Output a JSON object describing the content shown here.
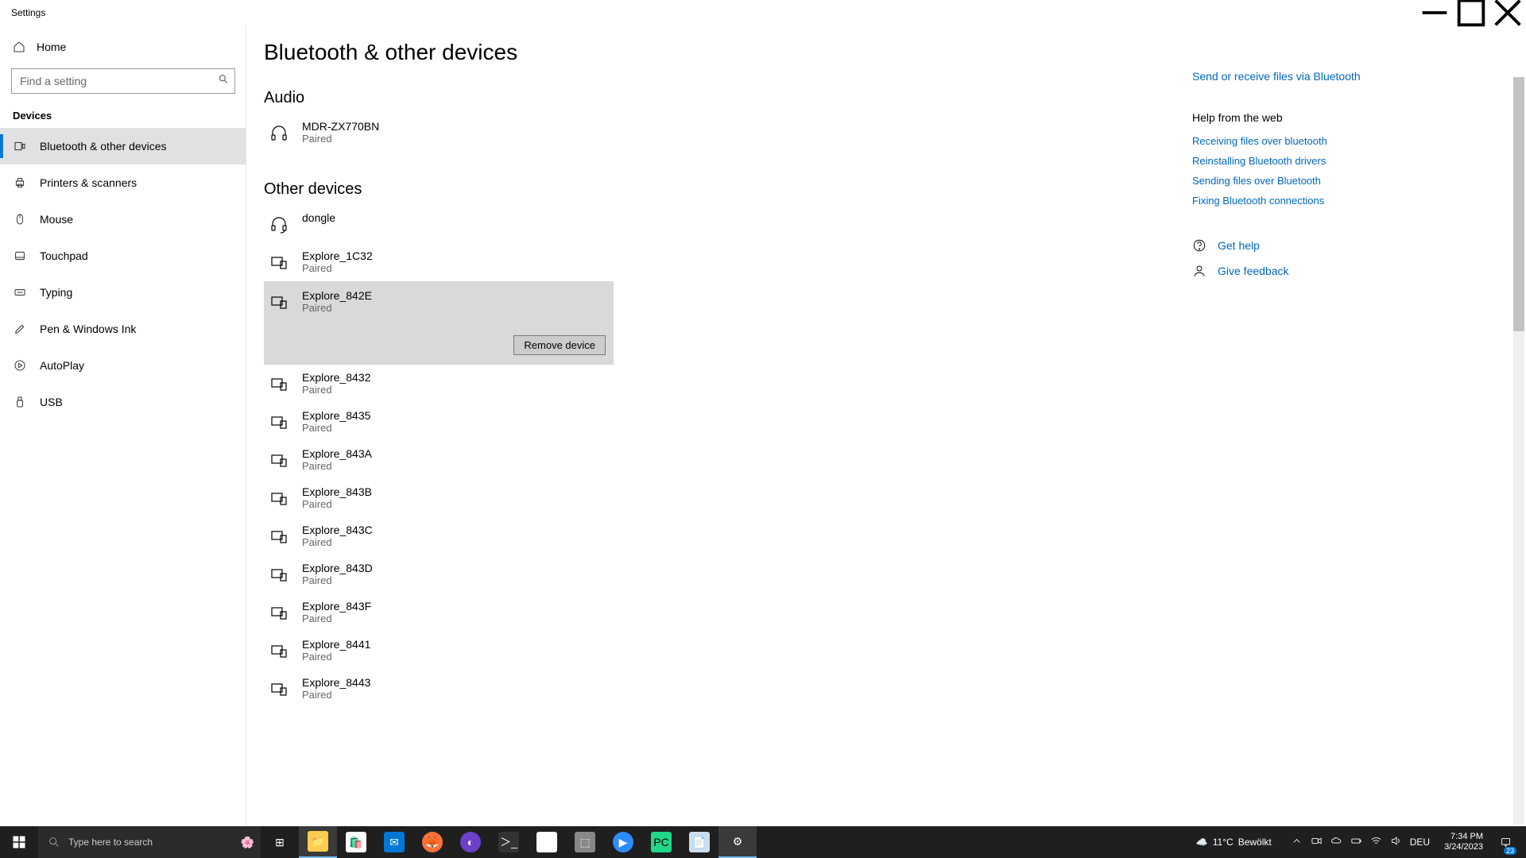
{
  "window": {
    "title": "Settings"
  },
  "sidebar": {
    "home": "Home",
    "search_placeholder": "Find a setting",
    "section": "Devices",
    "items": [
      {
        "label": "Bluetooth & other devices"
      },
      {
        "label": "Printers & scanners"
      },
      {
        "label": "Mouse"
      },
      {
        "label": "Touchpad"
      },
      {
        "label": "Typing"
      },
      {
        "label": "Pen & Windows Ink"
      },
      {
        "label": "AutoPlay"
      },
      {
        "label": "USB"
      }
    ]
  },
  "page": {
    "title": "Bluetooth & other devices",
    "audio_section": "Audio",
    "other_section": "Other devices",
    "remove_label": "Remove device",
    "audio_devices": [
      {
        "name": "MDR-ZX770BN",
        "status": "Paired"
      }
    ],
    "other_devices": [
      {
        "name": "dongle",
        "status": ""
      },
      {
        "name": "Explore_1C32",
        "status": "Paired"
      },
      {
        "name": "Explore_842E",
        "status": "Paired"
      },
      {
        "name": "Explore_8432",
        "status": "Paired"
      },
      {
        "name": "Explore_8435",
        "status": "Paired"
      },
      {
        "name": "Explore_843A",
        "status": "Paired"
      },
      {
        "name": "Explore_843B",
        "status": "Paired"
      },
      {
        "name": "Explore_843C",
        "status": "Paired"
      },
      {
        "name": "Explore_843D",
        "status": "Paired"
      },
      {
        "name": "Explore_843F",
        "status": "Paired"
      },
      {
        "name": "Explore_8441",
        "status": "Paired"
      },
      {
        "name": "Explore_8443",
        "status": "Paired"
      }
    ]
  },
  "rail": {
    "top_link": "Send or receive files via Bluetooth",
    "help_title": "Help from the web",
    "help_links": [
      "Receiving files over bluetooth",
      "Reinstalling Bluetooth drivers",
      "Sending files over Bluetooth",
      "Fixing Bluetooth connections"
    ],
    "get_help": "Get help",
    "feedback": "Give feedback"
  },
  "taskbar": {
    "search_placeholder": "Type here to search",
    "weather_temp": "11°C",
    "weather_text": "Bewölkt",
    "lang": "DEU",
    "time": "7:34 PM",
    "date": "3/24/2023",
    "notif_count": "23"
  }
}
